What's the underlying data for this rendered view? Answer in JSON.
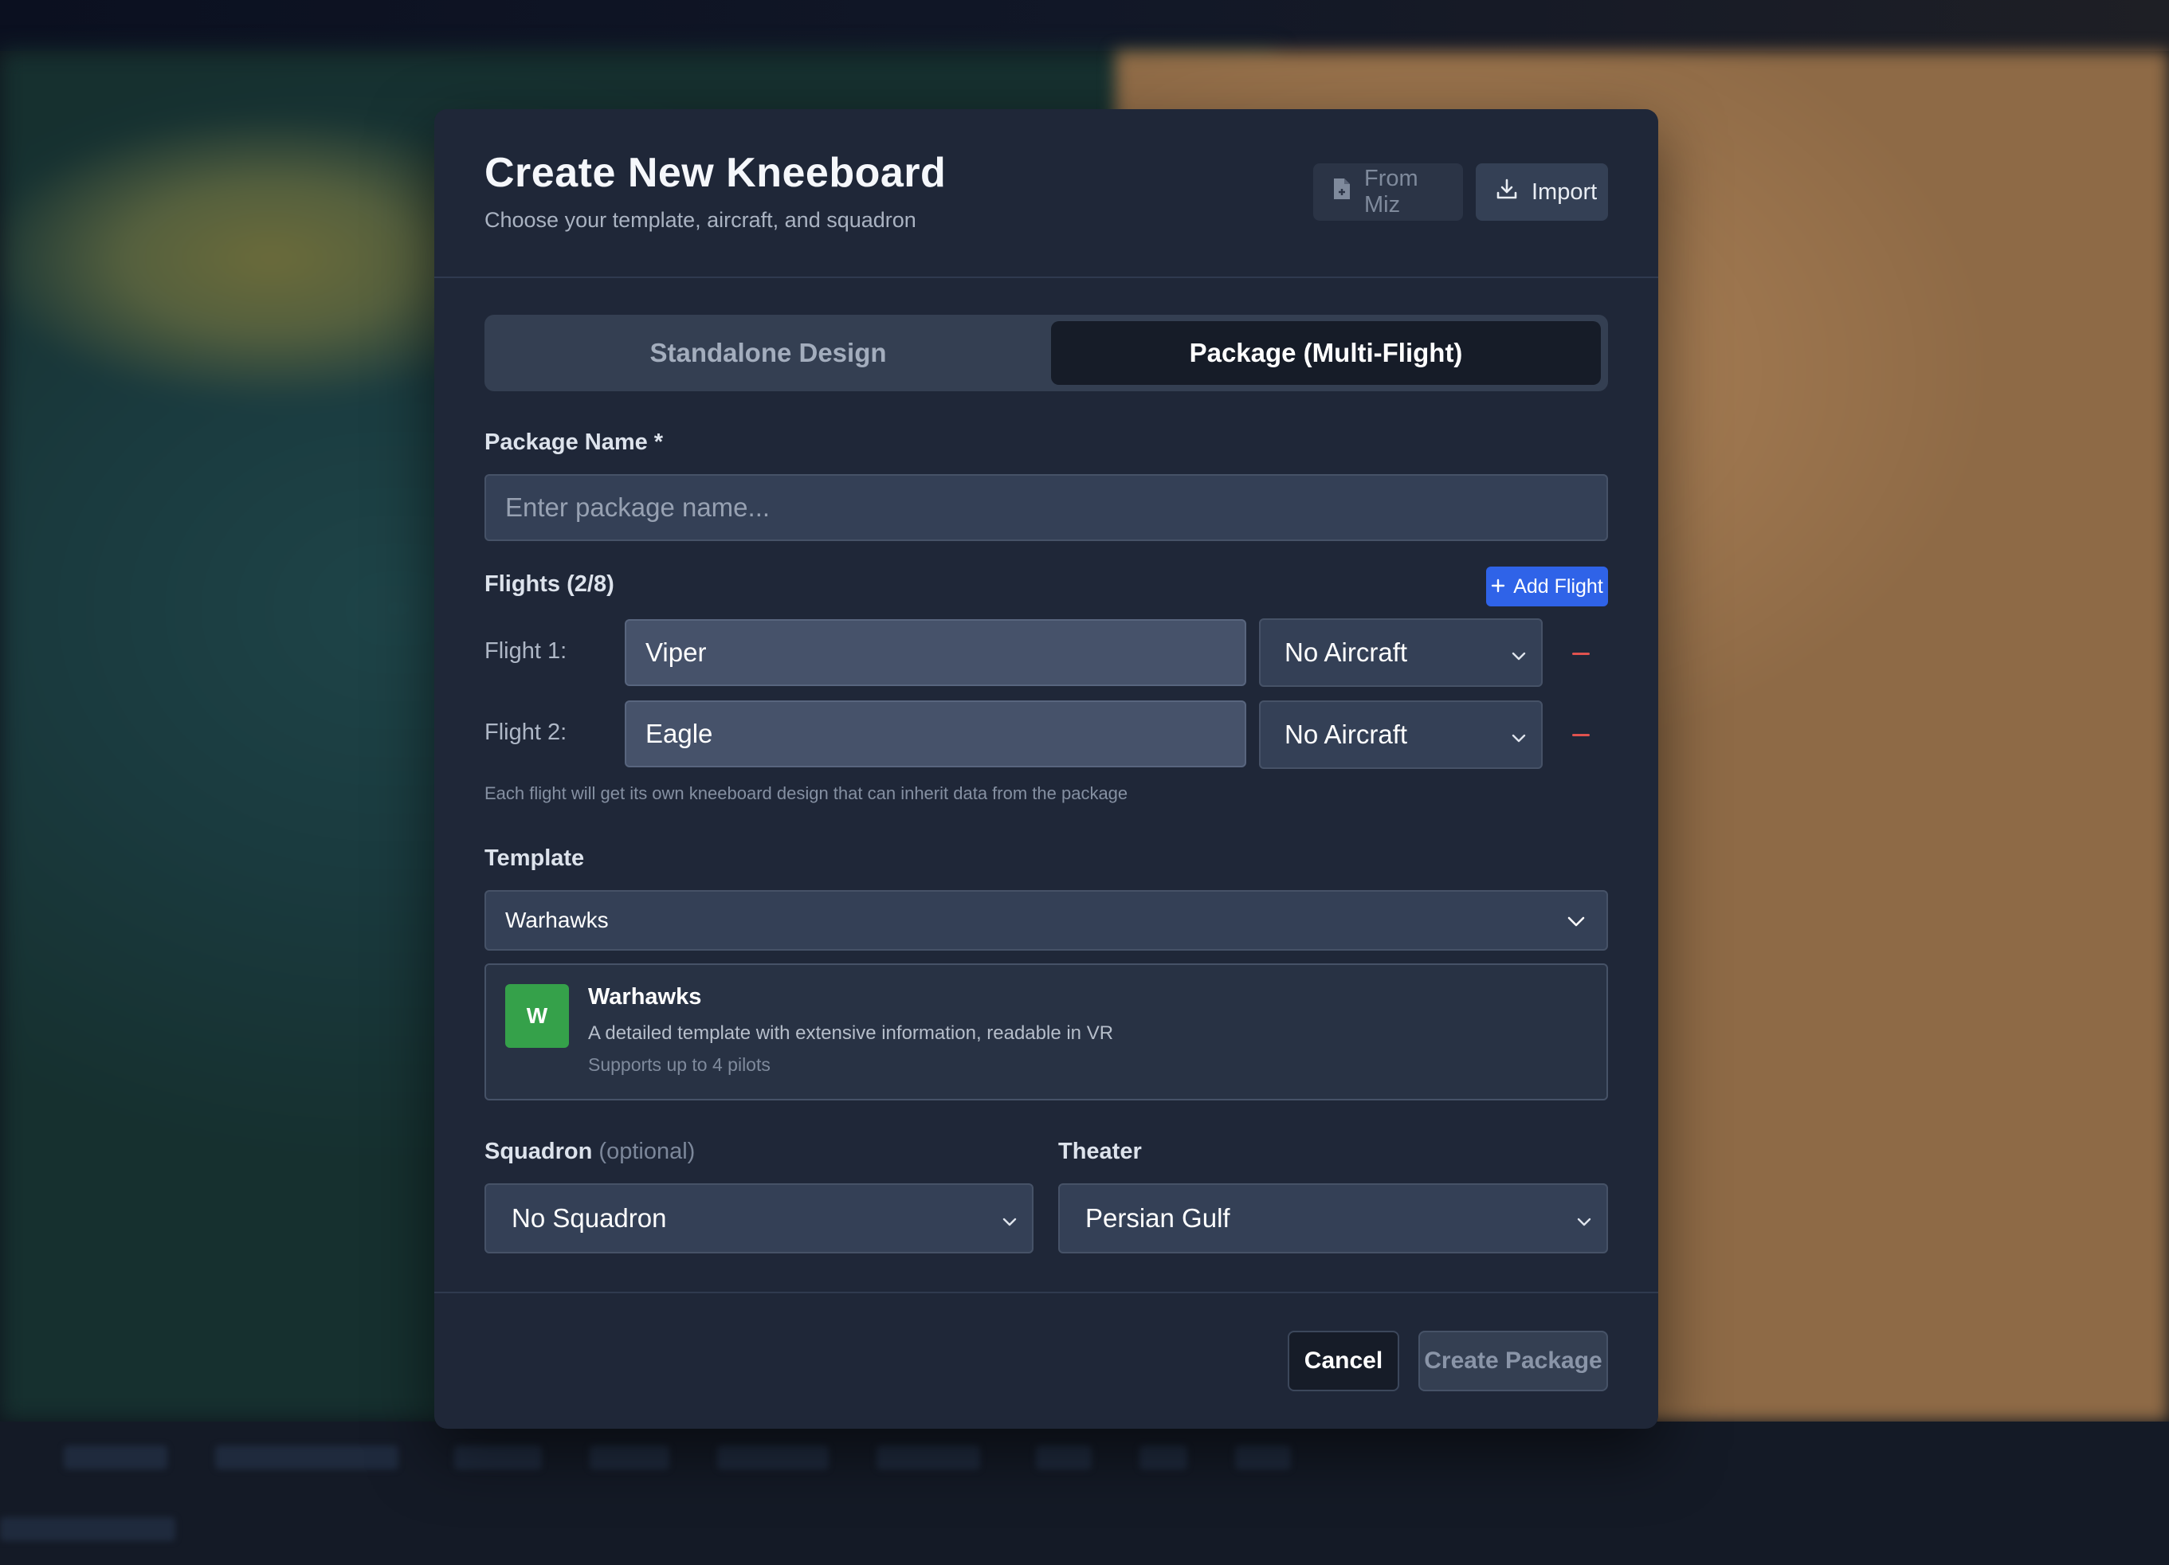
{
  "modal": {
    "title": "Create New Kneeboard",
    "subtitle": "Choose your template, aircraft, and squadron",
    "from_miz_label": "From Miz",
    "import_label": "Import"
  },
  "tabs": [
    {
      "label": "Standalone Design",
      "active": false
    },
    {
      "label": "Package (Multi-Flight)",
      "active": true
    }
  ],
  "package": {
    "name_label": "Package Name *",
    "name_value": "",
    "name_placeholder": "Enter package name..."
  },
  "flights": {
    "header": "Flights (2/8)",
    "add_label": "Add Flight",
    "items": [
      {
        "label": "Flight 1:",
        "name": "Viper",
        "aircraft": "No Aircraft"
      },
      {
        "label": "Flight 2:",
        "name": "Eagle",
        "aircraft": "No Aircraft"
      }
    ],
    "hint": "Each flight will get its own kneeboard design that can inherit data from the package"
  },
  "template": {
    "label": "Template",
    "selected": "Warhawks",
    "card": {
      "badge": "W",
      "name": "Warhawks",
      "description": "A detailed template with extensive information, readable in VR",
      "pilots": "Supports up to 4 pilots"
    }
  },
  "squadron": {
    "label": "Squadron",
    "optional": "(optional)",
    "selected": "No Squadron"
  },
  "theater": {
    "label": "Theater",
    "selected": "Persian Gulf"
  },
  "footer": {
    "cancel_label": "Cancel",
    "create_label": "Create Package"
  },
  "colors": {
    "modal_bg": "#1f2738",
    "accent_blue": "#2f63e8",
    "badge_green": "#35a14a",
    "remove_red": "#e0524f"
  },
  "icons": [
    "file-icon",
    "download-icon",
    "plus-icon",
    "chevron-down-icon",
    "minus-icon"
  ]
}
